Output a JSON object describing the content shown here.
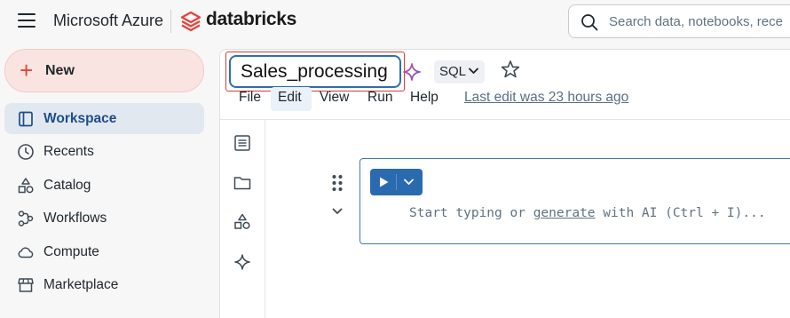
{
  "topbar": {
    "brand_microsoft": "Microsoft Azure",
    "brand_databricks": "databricks",
    "search_placeholder": "Search data, notebooks, rece"
  },
  "sidebar": {
    "new_label": "New",
    "items": [
      {
        "label": "Workspace",
        "icon": "workspace-icon",
        "active": true
      },
      {
        "label": "Recents",
        "icon": "clock-icon"
      },
      {
        "label": "Catalog",
        "icon": "catalog-icon"
      },
      {
        "label": "Workflows",
        "icon": "workflows-icon"
      },
      {
        "label": "Compute",
        "icon": "cloud-icon"
      },
      {
        "label": "Marketplace",
        "icon": "store-icon"
      }
    ]
  },
  "notebook": {
    "title": "Sales_processing",
    "language": "SQL",
    "menu": [
      "File",
      "Edit",
      "View",
      "Run",
      "Help"
    ],
    "last_edit": "Last edit was 23 hours ago",
    "cell": {
      "placeholder_pre": "Start typing or ",
      "placeholder_link": "generate",
      "placeholder_post": " with AI (Ctrl + I)..."
    }
  },
  "colors": {
    "accent": "#2a6bb0",
    "new_button_bg": "#fae4e1",
    "brand_red": "#e3453c",
    "active_nav_bg": "#e2e8ef",
    "highlight_box": "#d93b3b"
  }
}
